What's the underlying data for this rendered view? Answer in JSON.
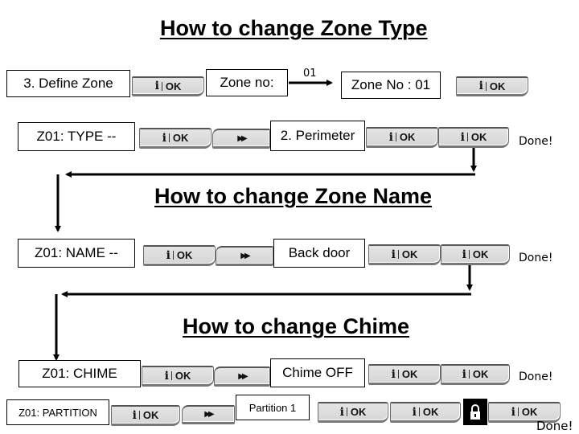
{
  "sections": {
    "zone_type": {
      "title": "How to change Zone Type",
      "row1": {
        "define_zone": "3. Define Zone",
        "ok": "OK",
        "zone_no_prompt": "Zone no:",
        "arrow_label": "01",
        "zone_no_value": "Zone No : 01",
        "ok2": "OK"
      },
      "row2": {
        "display": "Z01: TYPE  --",
        "ok": "OK",
        "next": "▶▶",
        "value": "2. Perimeter",
        "ok2": "OK",
        "ok3": "OK",
        "done": "Done!"
      }
    },
    "zone_name": {
      "title": "How to change Zone Name",
      "row": {
        "display": "Z01: NAME  --",
        "ok": "OK",
        "next": "▶▶",
        "value": "Back door",
        "ok2": "OK",
        "ok3": "OK",
        "done": "Done!"
      }
    },
    "chime": {
      "title": "How to change Chime",
      "row": {
        "display": "Z01: CHIME",
        "ok": "OK",
        "next": "▶▶",
        "value": "Chime OFF",
        "ok2": "OK",
        "ok3": "OK",
        "done": "Done!"
      }
    },
    "partition": {
      "row": {
        "display": "Z01: PARTITION",
        "ok": "OK",
        "next": "▶▶",
        "value": "Partition 1",
        "ok2": "OK",
        "ok3": "OK",
        "lock": "lock-icon",
        "ok4": "OK",
        "done": "Done!"
      }
    }
  },
  "button_icon": "info-icon",
  "colors": {
    "button_face": "#dcdcdc",
    "lock_background": "#000000",
    "line": "#000000"
  }
}
